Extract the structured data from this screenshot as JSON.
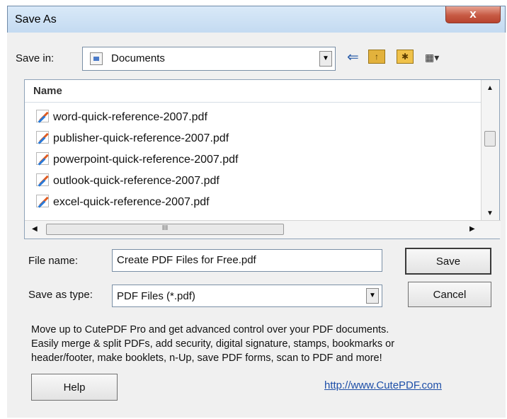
{
  "window": {
    "title": "Save As",
    "close_glyph": "x"
  },
  "toolbar": {
    "save_in_label": "Save in:",
    "location": "Documents",
    "icons": [
      "back-icon",
      "up-folder-icon",
      "new-folder-icon",
      "views-menu-icon"
    ]
  },
  "filelist": {
    "header": "Name",
    "files": [
      "word-quick-reference-2007.pdf",
      "publisher-quick-reference-2007.pdf",
      "powerpoint-quick-reference-2007.pdf",
      "outlook-quick-reference-2007.pdf",
      "excel-quick-reference-2007.pdf"
    ],
    "hscroll_thumb_glyph": "III"
  },
  "form": {
    "filename_label": "File name:",
    "filename_value": "Create PDF Files for Free.pdf",
    "type_label": "Save as type:",
    "type_value": "PDF Files (*.pdf)",
    "save_button": "Save",
    "cancel_button": "Cancel"
  },
  "promo": {
    "lines": [
      "Move up to CutePDF Pro and get advanced control over your PDF documents.",
      "Easily merge & split PDFs, add security, digital signature, stamps, bookmarks or",
      "header/footer, make booklets, n-Up, save PDF forms, scan to PDF and more!"
    ]
  },
  "footer": {
    "help_button": "Help",
    "link": "http://www.CutePDF.com"
  },
  "colors": {
    "titlebar": "#c3daf1",
    "close_button": "#c75a44",
    "link": "#1e4fa8"
  }
}
